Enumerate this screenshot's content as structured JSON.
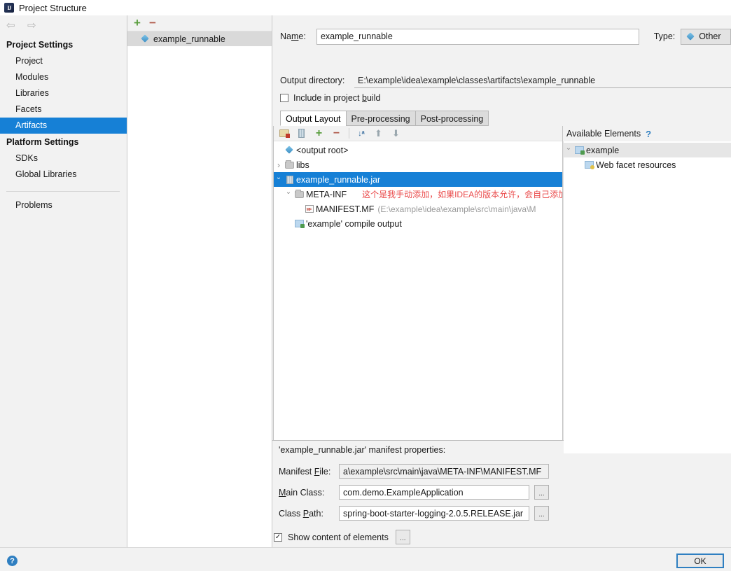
{
  "window": {
    "title": "Project Structure",
    "logo_icon": "intellij-idea-logo"
  },
  "nav": {
    "back_icon": "arrow-left-icon",
    "forward_icon": "arrow-right-icon"
  },
  "sidebar": {
    "groups": [
      {
        "label": "Project Settings",
        "items": [
          {
            "label": "Project",
            "selected": false
          },
          {
            "label": "Modules",
            "selected": false
          },
          {
            "label": "Libraries",
            "selected": false
          },
          {
            "label": "Facets",
            "selected": false
          },
          {
            "label": "Artifacts",
            "selected": true
          }
        ]
      },
      {
        "label": "Platform Settings",
        "items": [
          {
            "label": "SDKs",
            "selected": false
          },
          {
            "label": "Global Libraries",
            "selected": false
          }
        ]
      }
    ],
    "problems": {
      "label": "Problems"
    }
  },
  "artifacts_panel": {
    "toolbar": {
      "add_label": "+",
      "remove_label": "−"
    },
    "items": [
      {
        "label": "example_runnable",
        "icon": "artifact-diamond-icon",
        "selected": true
      }
    ]
  },
  "editor": {
    "name": {
      "label": "Name:",
      "label_pre": "Na",
      "label_u": "m",
      "label_post": "e:",
      "value": "example_runnable"
    },
    "type": {
      "label": "Type:",
      "value": "Other",
      "icon": "artifact-diamond-icon"
    },
    "output_directory": {
      "label": "Output directory:",
      "value": "E:\\example\\idea\\example\\classes\\artifacts\\example_runnable"
    },
    "include_in_build": {
      "label_pre": "Include in project ",
      "label_u": "b",
      "label_post": "uild",
      "checked": false,
      "check_glyph": ""
    },
    "tabs": [
      {
        "label": "Output Layout",
        "active": true
      },
      {
        "label": "Pre-processing",
        "active": false
      },
      {
        "label": "Post-processing",
        "active": false
      }
    ],
    "layout_toolbar": [
      {
        "name": "add-directory-icon"
      },
      {
        "name": "add-archive-icon"
      },
      {
        "name": "add-copy-of-icon"
      },
      {
        "name": "remove-icon"
      },
      {
        "name": "sort-alphabetically-icon"
      },
      {
        "name": "move-up-icon"
      },
      {
        "name": "move-down-icon"
      }
    ],
    "tree": [
      {
        "indent": 0,
        "twisty": "none",
        "icon": "output-root-icon",
        "label": "<output root>",
        "path": "",
        "annotation": "",
        "selected": false
      },
      {
        "indent": 0,
        "twisty": "closed",
        "icon": "folder-icon",
        "label": "libs",
        "path": "",
        "annotation": "",
        "selected": false
      },
      {
        "indent": 0,
        "twisty": "open",
        "icon": "jar-icon",
        "label": "example_runnable.jar",
        "path": "",
        "annotation": "",
        "selected": true
      },
      {
        "indent": 1,
        "twisty": "open",
        "icon": "folder-icon",
        "label": "META-INF",
        "path": "",
        "annotation": "这个是我手动添加，如果IDEA的版本允许，会自己添加进去",
        "selected": false
      },
      {
        "indent": 2,
        "twisty": "none",
        "icon": "manifest-file-icon",
        "label": "MANIFEST.MF",
        "path": "(E:\\example\\idea\\example\\src\\main\\java\\M",
        "annotation": "",
        "selected": false
      },
      {
        "indent": 1,
        "twisty": "none",
        "icon": "module-output-icon",
        "label": "'example' compile output",
        "path": "",
        "annotation": "",
        "selected": false
      }
    ],
    "available_elements": {
      "title": "Available Elements",
      "help_glyph": "?",
      "items": [
        {
          "indent": 0,
          "twisty": "open",
          "icon": "module-icon",
          "label": "example",
          "highlight": true
        },
        {
          "indent": 1,
          "twisty": "none",
          "icon": "web-facet-icon",
          "label": "Web facet resources",
          "highlight": false
        }
      ]
    }
  },
  "manifest": {
    "title": "'example_runnable.jar' manifest properties:",
    "fields": [
      {
        "label_pre": "Manifest ",
        "label_u": "F",
        "label_post": "ile:",
        "value": "a\\example\\src\\main\\java\\META-INF\\MANIFEST.MF",
        "has_browse": false
      },
      {
        "label_pre": "",
        "label_u": "M",
        "label_post": "ain Class:",
        "value": "com.demo.ExampleApplication",
        "has_browse": true,
        "browse_label": "..."
      },
      {
        "label_pre": "Class ",
        "label_u": "P",
        "label_post": "ath:",
        "value": "spring-boot-starter-logging-2.0.5.RELEASE.jar",
        "has_browse": true,
        "browse_label": "..."
      }
    ],
    "show_content": {
      "label": "Show content of elements",
      "checked": true,
      "check_glyph": "✓",
      "browse_label": "..."
    }
  },
  "bottom": {
    "help_glyph": "?",
    "ok_label": "OK"
  },
  "colors": {
    "selection": "#1680d6",
    "accent": "#2f7fc1",
    "annotation_red": "#ea4a4a",
    "panel_bg": "#f2f2f2"
  }
}
